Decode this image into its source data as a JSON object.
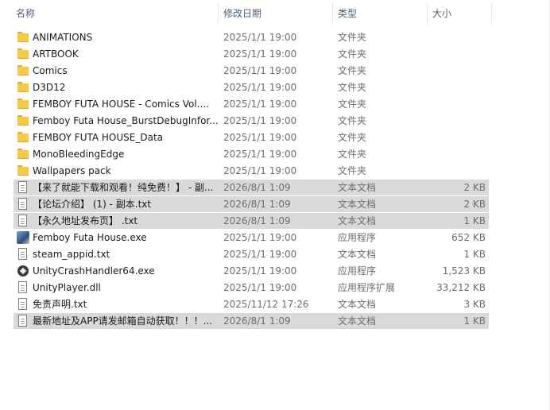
{
  "header": {
    "name": "名称",
    "date": "修改日期",
    "type": "类型",
    "size": "大小",
    "sort_indicator": "^"
  },
  "files": [
    {
      "icon": "folder-icon",
      "name": "ANIMATIONS",
      "date": "2025/1/1 19:00",
      "type": "文件夹",
      "size": "",
      "selected": false
    },
    {
      "icon": "folder-icon",
      "name": "ARTBOOK",
      "date": "2025/1/1 19:00",
      "type": "文件夹",
      "size": "",
      "selected": false
    },
    {
      "icon": "folder-icon",
      "name": "Comics",
      "date": "2025/1/1 19:00",
      "type": "文件夹",
      "size": "",
      "selected": false
    },
    {
      "icon": "folder-icon",
      "name": "D3D12",
      "date": "2025/1/1 19:00",
      "type": "文件夹",
      "size": "",
      "selected": false
    },
    {
      "icon": "folder-icon",
      "name": "FEMBOY FUTA HOUSE - Comics Vol....",
      "date": "2025/1/1 19:00",
      "type": "文件夹",
      "size": "",
      "selected": false
    },
    {
      "icon": "folder-icon",
      "name": "Femboy Futa House_BurstDebugInfor...",
      "date": "2025/1/1 19:00",
      "type": "文件夹",
      "size": "",
      "selected": false
    },
    {
      "icon": "folder-icon",
      "name": "FEMBOY FUTA HOUSE_Data",
      "date": "2025/1/1 19:00",
      "type": "文件夹",
      "size": "",
      "selected": false
    },
    {
      "icon": "folder-icon",
      "name": "MonoBleedingEdge",
      "date": "2025/1/1 19:00",
      "type": "文件夹",
      "size": "",
      "selected": false
    },
    {
      "icon": "folder-icon",
      "name": "Wallpapers pack",
      "date": "2025/1/1 19:00",
      "type": "文件夹",
      "size": "",
      "selected": false
    },
    {
      "icon": "text-file-icon",
      "name": "【来了就能下载和观看！纯免费！】 - 副...",
      "date": "2026/8/1 1:09",
      "type": "文本文档",
      "size": "2 KB",
      "selected": true
    },
    {
      "icon": "text-file-icon",
      "name": "【论坛介绍】 (1) - 副本.txt",
      "date": "2026/8/1 1:09",
      "type": "文本文档",
      "size": "2 KB",
      "selected": true
    },
    {
      "icon": "text-file-icon",
      "name": "【永久地址发布页】 .txt",
      "date": "2026/8/1 1:09",
      "type": "文本文档",
      "size": "1 KB",
      "selected": true
    },
    {
      "icon": "game-exe-icon",
      "name": "Femboy Futa House.exe",
      "date": "2025/1/1 19:00",
      "type": "应用程序",
      "size": "652 KB",
      "selected": false
    },
    {
      "icon": "text-file-icon",
      "name": "steam_appid.txt",
      "date": "2025/1/1 19:00",
      "type": "文本文档",
      "size": "1 KB",
      "selected": false
    },
    {
      "icon": "unity-exe-icon",
      "name": "UnityCrashHandler64.exe",
      "date": "2025/1/1 19:00",
      "type": "应用程序",
      "size": "1,523 KB",
      "selected": false
    },
    {
      "icon": "dll-file-icon",
      "name": "UnityPlayer.dll",
      "date": "2025/1/1 19:00",
      "type": "应用程序扩展",
      "size": "33,212 KB",
      "selected": false
    },
    {
      "icon": "text-file-icon",
      "name": "免责声明.txt",
      "date": "2025/11/12 17:26",
      "type": "文本文档",
      "size": "3 KB",
      "selected": false
    },
    {
      "icon": "text-file-icon",
      "name": "最新地址及APP请发邮箱自动获取！！！...",
      "date": "2026/8/1 1:09",
      "type": "文本文档",
      "size": "1 KB",
      "selected": true
    }
  ]
}
